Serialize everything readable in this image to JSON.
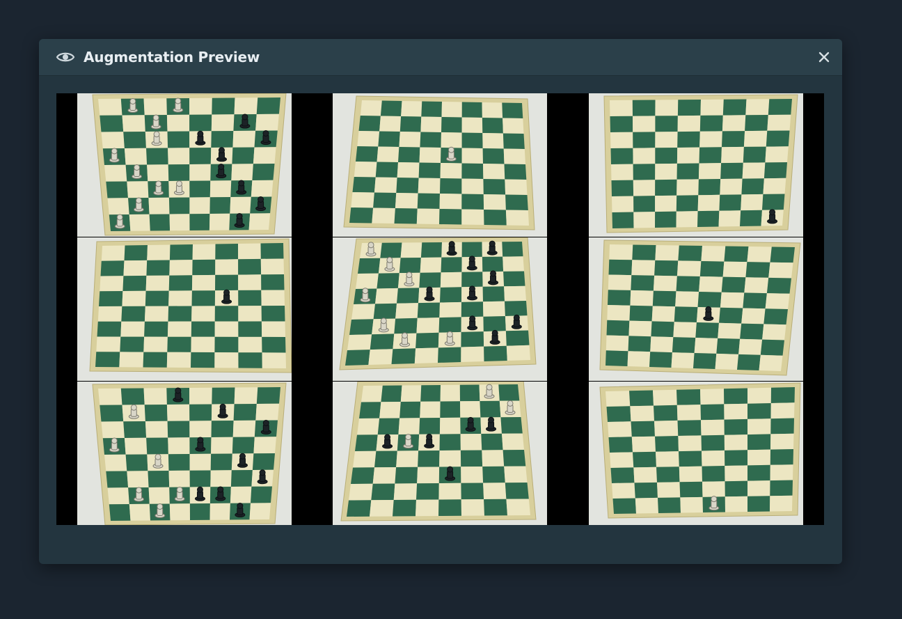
{
  "dialog": {
    "title": "Augmentation Preview",
    "icon": "eye-icon",
    "close_icon": "close-icon"
  },
  "preview": {
    "columns": 3,
    "rows": 3,
    "tiles": [
      {
        "id": "tile-1",
        "pieces": "many"
      },
      {
        "id": "tile-2",
        "pieces": "one"
      },
      {
        "id": "tile-3",
        "pieces": "one"
      },
      {
        "id": "tile-4",
        "pieces": "one"
      },
      {
        "id": "tile-5",
        "pieces": "many"
      },
      {
        "id": "tile-6",
        "pieces": "one"
      },
      {
        "id": "tile-7",
        "pieces": "many"
      },
      {
        "id": "tile-8",
        "pieces": "several"
      },
      {
        "id": "tile-9",
        "pieces": "one"
      }
    ]
  },
  "colors": {
    "page_bg": "#1b2530",
    "modal_bg": "#23353f",
    "header_bg": "#2b404a",
    "board_dark": "#2f6b4f",
    "board_light": "#ece6c2",
    "board_border": "#d8cf9c"
  }
}
